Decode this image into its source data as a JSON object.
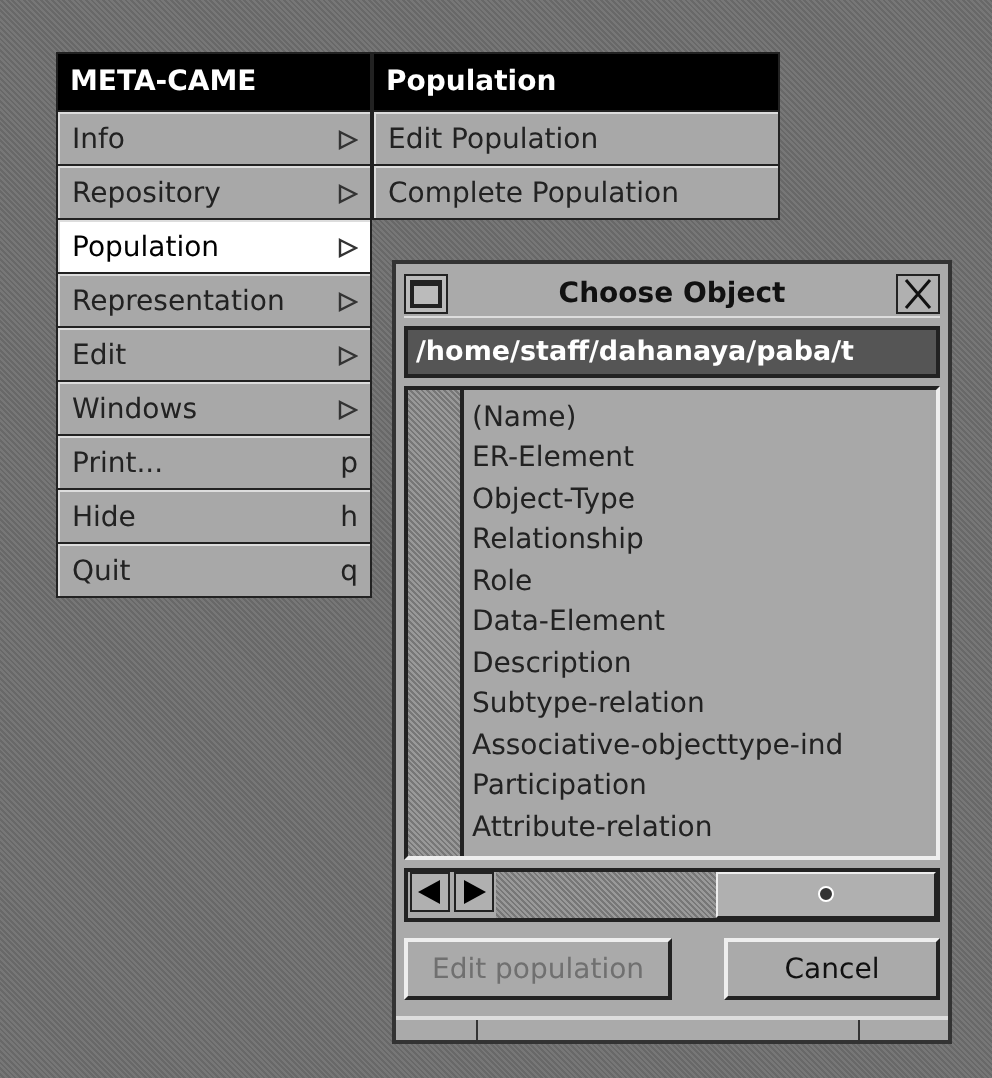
{
  "menu": {
    "title": "META-CAME",
    "items": [
      {
        "label": "Info",
        "kind": "submenu",
        "selected": false
      },
      {
        "label": "Repository",
        "kind": "submenu",
        "selected": false
      },
      {
        "label": "Population",
        "kind": "submenu",
        "selected": true
      },
      {
        "label": "Representation",
        "kind": "submenu",
        "selected": false
      },
      {
        "label": "Edit",
        "kind": "submenu",
        "selected": false
      },
      {
        "label": "Windows",
        "kind": "submenu",
        "selected": false
      },
      {
        "label": "Print...",
        "kind": "shortcut",
        "shortcut": "p",
        "selected": false
      },
      {
        "label": "Hide",
        "kind": "shortcut",
        "shortcut": "h",
        "selected": false
      },
      {
        "label": "Quit",
        "kind": "shortcut",
        "shortcut": "q",
        "selected": false
      }
    ]
  },
  "submenu": {
    "title": "Population",
    "items": [
      "Edit Population",
      "Complete Population"
    ]
  },
  "dialog": {
    "title": "Choose Object",
    "path": "/home/staff/dahanaya/paba/t",
    "items": [
      "(Name)",
      "ER-Element",
      "Object-Type",
      "Relationship",
      "Role",
      "Data-Element",
      "Description",
      "Subtype-relation",
      "Associative-objecttype-ind",
      "Participation",
      "Attribute-relation"
    ],
    "buttons": [
      {
        "label": "Edit population",
        "disabled": true
      },
      {
        "label": "Cancel",
        "disabled": false
      }
    ]
  }
}
